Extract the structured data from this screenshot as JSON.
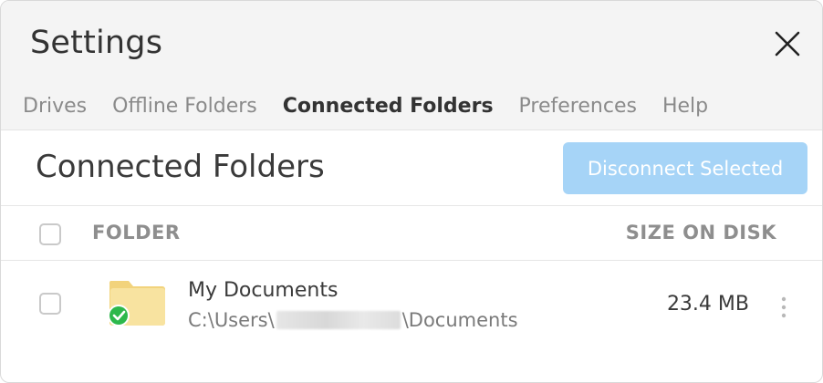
{
  "window": {
    "title": "Settings"
  },
  "tabs": [
    {
      "label": "Drives",
      "active": false
    },
    {
      "label": "Offline Folders",
      "active": false
    },
    {
      "label": "Connected Folders",
      "active": true
    },
    {
      "label": "Preferences",
      "active": false
    },
    {
      "label": "Help",
      "active": false
    }
  ],
  "main": {
    "section_title": "Connected Folders",
    "disconnect_label": "Disconnect Selected",
    "table": {
      "columns": [
        "FOLDER",
        "SIZE ON DISK"
      ],
      "rows": [
        {
          "name": "My Documents",
          "path_prefix": "C:\\Users\\",
          "path_suffix": "\\Documents",
          "size": "23.4 MB",
          "status": "synced",
          "checked": false
        }
      ]
    }
  },
  "icons": {
    "close": "close-icon",
    "folder": "folder-icon",
    "status": "check-circle-icon",
    "more": "more-vertical-icon"
  },
  "colors": {
    "accent_button_disabled": "#a6d4f7",
    "folder": "#f7e19a",
    "success": "#2db84b",
    "header_bg": "#f4f4f4"
  }
}
